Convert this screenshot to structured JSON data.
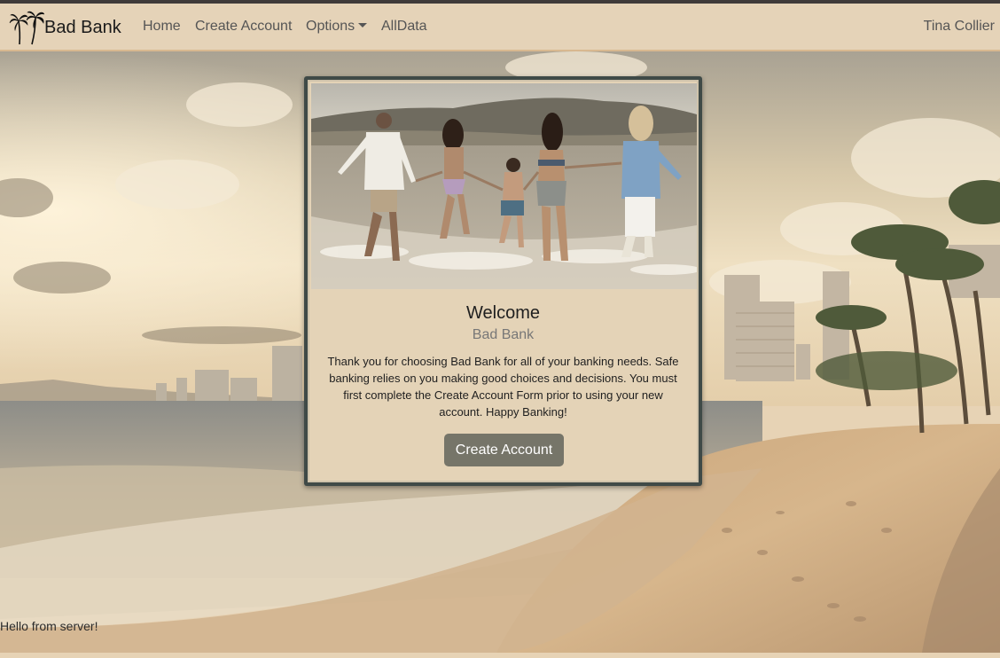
{
  "navbar": {
    "brand": "Bad Bank",
    "brand_icon": "palm-trees-icon",
    "links": {
      "home": "Home",
      "create_account": "Create Account",
      "options": "Options",
      "all_data": "AllData"
    },
    "user": "Tina Collier"
  },
  "card": {
    "title": "Welcome",
    "subtitle": "Bad Bank",
    "text": "Thank you for choosing Bad Bank for all of your banking needs. Safe banking relies on you making good choices and decisions. You must first complete the Create Account Form prior to using your new account. Happy Banking!",
    "button": "Create Account"
  },
  "server_message": "Hello from server!",
  "colors": {
    "navbar_bg": "#e5d3b8",
    "card_bg": "#e4d3b7",
    "card_border": "#3f4a47",
    "button_bg": "#767569"
  }
}
